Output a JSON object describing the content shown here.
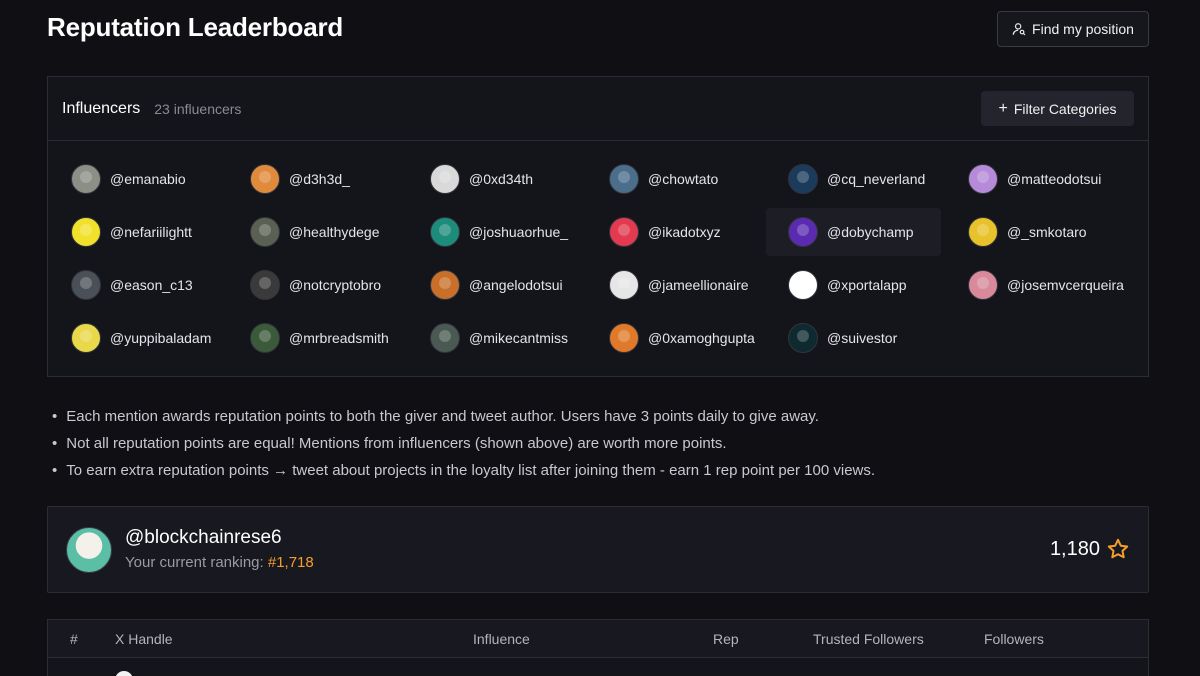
{
  "page": {
    "title": "Reputation Leaderboard",
    "find_button_label": "Find my position"
  },
  "influencers": {
    "title": "Influencers",
    "count_label": "23 influencers",
    "filter_label": "Filter Categories",
    "items": [
      {
        "handle": "@emanabio",
        "color": "#8b8f86"
      },
      {
        "handle": "@d3h3d_",
        "color": "#e08a3c"
      },
      {
        "handle": "@0xd34th",
        "color": "#d9d9d9"
      },
      {
        "handle": "@chowtato",
        "color": "#4a6e8c"
      },
      {
        "handle": "@cq_neverland",
        "color": "#1a3b5c"
      },
      {
        "handle": "@matteodotsui",
        "color": "#b58ad8"
      },
      {
        "handle": "@nefariilightt",
        "color": "#f2e12a"
      },
      {
        "handle": "@healthydege",
        "color": "#5a6052"
      },
      {
        "handle": "@joshuaorhue_",
        "color": "#1d8c7a"
      },
      {
        "handle": "@ikadotxyz",
        "color": "#e23a4e"
      },
      {
        "handle": "@dobychamp",
        "color": "#5a2bb0"
      },
      {
        "handle": "@_smkotaro",
        "color": "#e8c22a"
      },
      {
        "handle": "@eason_c13",
        "color": "#4a5058"
      },
      {
        "handle": "@notcryptobro",
        "color": "#3a3a3a"
      },
      {
        "handle": "@angelodotsui",
        "color": "#c8702a"
      },
      {
        "handle": "@jameellionaire",
        "color": "#e6e6e6"
      },
      {
        "handle": "@xportalapp",
        "color": "#ffffff"
      },
      {
        "handle": "@josemvcerqueira",
        "color": "#d88a9a"
      },
      {
        "handle": "@yuppibaladam",
        "color": "#e8d84a"
      },
      {
        "handle": "@mrbreadsmith",
        "color": "#3a5a3a"
      },
      {
        "handle": "@mikecantmiss",
        "color": "#4a5a52"
      },
      {
        "handle": "@0xamoghgupta",
        "color": "#e07a2a"
      },
      {
        "handle": "@suivestor",
        "color": "#0e2a30"
      }
    ]
  },
  "info": {
    "bullets": [
      "Each mention awards reputation points to both the giver and tweet author. Users have 3 points daily to give away.",
      "Not all reputation points are equal! Mentions from influencers (shown above) are worth more points.",
      "To earn extra reputation points → tweet about projects in the loyalty list after joining them - earn 1 rep point per 100 views."
    ]
  },
  "me": {
    "handle": "@blockchainrese6",
    "rank_prefix": "Your current ranking: ",
    "rank_value": "#1,718",
    "score": "1,180"
  },
  "table": {
    "headers": [
      "#",
      "X Handle",
      "Influence",
      "Rep",
      "Trusted Followers",
      "Followers"
    ]
  },
  "colors": {
    "accent": "#f59e2a",
    "background": "#0f0f14",
    "panel": "#14141b"
  }
}
